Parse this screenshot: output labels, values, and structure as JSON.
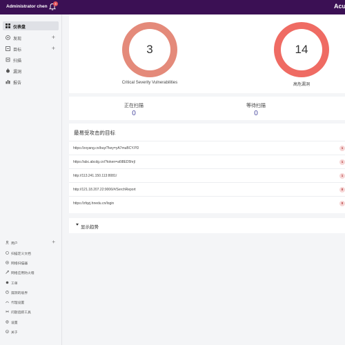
{
  "topbar": {
    "user": "Administrator chen",
    "notification_count": "4",
    "brand": "Acu"
  },
  "sidebar": {
    "items": [
      {
        "label": "仪表盘",
        "icon": "dashboard-icon",
        "active": true,
        "plus": ""
      },
      {
        "label": "发现",
        "icon": "discover-icon",
        "active": false,
        "plus": "+"
      },
      {
        "label": "目标",
        "icon": "targets-icon",
        "active": false,
        "plus": "+"
      },
      {
        "label": "扫描",
        "icon": "scan-icon",
        "active": false,
        "plus": ""
      },
      {
        "label": "漏洞",
        "icon": "vulnerability-icon",
        "active": false,
        "plus": ""
      },
      {
        "label": "报告",
        "icon": "report-icon",
        "active": false,
        "plus": ""
      }
    ],
    "bottom_items": [
      {
        "label": "用户",
        "icon": "user-icon",
        "plus": "+"
      },
      {
        "label": "扫描定义文档",
        "icon": "scan-profile-icon",
        "plus": ""
      },
      {
        "label": "网络扫描器",
        "icon": "network-scanner-icon",
        "plus": ""
      },
      {
        "label": "网络应用防火墙",
        "icon": "waf-icon",
        "plus": ""
      },
      {
        "label": "工单",
        "icon": "ticket-icon",
        "plus": ""
      },
      {
        "label": "漏洞的境界",
        "icon": "vuln-scope-icon",
        "plus": ""
      },
      {
        "label": "代理设置",
        "icon": "proxy-icon",
        "plus": ""
      },
      {
        "label": "问题追踪工具",
        "icon": "issue-tracker-icon",
        "plus": ""
      },
      {
        "label": "设置",
        "icon": "settings-icon",
        "plus": ""
      },
      {
        "label": "关于",
        "icon": "about-icon",
        "plus": ""
      }
    ]
  },
  "stats": {
    "critical": {
      "value": "3",
      "label": "Critical Severity Vulnerabilities",
      "color": "#e48a7a"
    },
    "high": {
      "value": "14",
      "label": "高危漏洞",
      "color": "#ef6b63"
    }
  },
  "scans": {
    "running_label": "正在扫描",
    "running_value": "0",
    "waiting_label": "等待扫描",
    "waiting_value": "0"
  },
  "targets": {
    "title": "最易受攻击的目标",
    "rows": [
      {
        "url": "https://zxyang.cn/buy/?key=yA7muBCY.PD",
        "count": "1"
      },
      {
        "url": "https://abc.abcdg.cn/?token=a6l8ED5hrjl",
        "count": "1"
      },
      {
        "url": "http://113.241.150.113:8081/",
        "count": "1"
      },
      {
        "url": "http://121.18.207.22:9006/#/SerchReport",
        "count": "0"
      },
      {
        "url": "https://zfqzj.hnedu.cn/login",
        "count": "0"
      }
    ]
  },
  "trend": {
    "label": "显示趋势"
  }
}
